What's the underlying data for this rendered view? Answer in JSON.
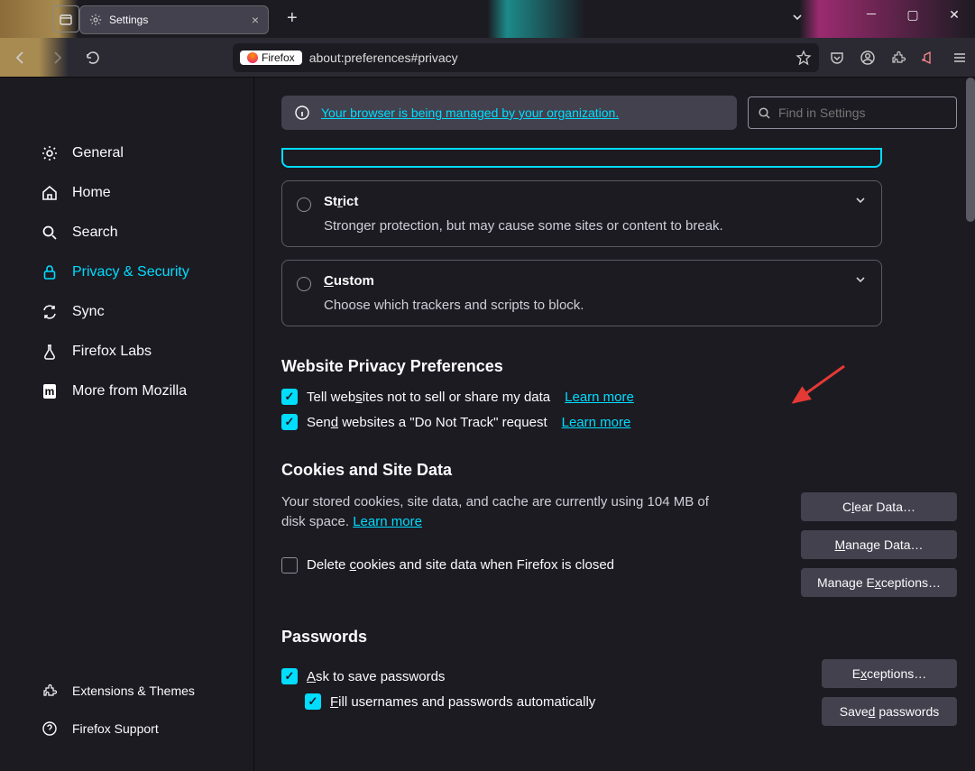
{
  "window": {
    "tab_title": "Settings"
  },
  "toolbar": {
    "firefox_chip": "Firefox",
    "url": "about:preferences#privacy"
  },
  "toprow": {
    "notice_text": "Your browser is being managed by your organization.",
    "search_placeholder": "Find in Settings"
  },
  "sidebar": {
    "general": "General",
    "home": "Home",
    "search": "Search",
    "privacy": "Privacy & Security",
    "sync": "Sync",
    "labs": "Firefox Labs",
    "mozilla": "More from Mozilla",
    "extensions": "Extensions & Themes",
    "support": "Firefox Support"
  },
  "tracking": {
    "strict_title": "Strict",
    "strict_desc": "Stronger protection, but may cause some sites or content to break.",
    "custom_title": "Custom",
    "custom_desc": "Choose which trackers and scripts to block."
  },
  "wpp": {
    "heading": "Website Privacy Preferences",
    "opt1": "Tell websites not to sell or share my data",
    "opt2": "Send websites a \"Do Not Track\" request",
    "learn": "Learn more"
  },
  "cookies": {
    "heading": "Cookies and Site Data",
    "desc_a": "Your stored cookies, site data, and cache are currently using 104 MB of disk space. ",
    "learn": "Learn more",
    "delete_chk": "Delete cookies and site data when Firefox is closed",
    "btn_clear": "Clear Data…",
    "btn_manage": "Manage Data…",
    "btn_exceptions": "Manage Exceptions…"
  },
  "passwords": {
    "heading": "Passwords",
    "ask": "Ask to save passwords",
    "fill": "Fill usernames and passwords automatically",
    "btn_exceptions": "Exceptions…",
    "btn_saved": "Saved passwords"
  }
}
